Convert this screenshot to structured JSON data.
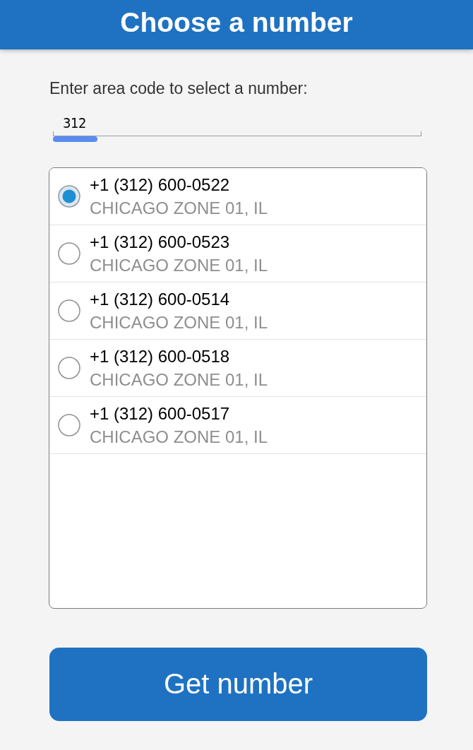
{
  "header": {
    "title": "Choose a number"
  },
  "area_code": {
    "label": "Enter area code to select a number:",
    "value": "312"
  },
  "numbers": [
    {
      "number": "+1 (312) 600-0522",
      "location": "CHICAGO ZONE 01, IL",
      "selected": true
    },
    {
      "number": "+1 (312) 600-0523",
      "location": "CHICAGO ZONE 01, IL",
      "selected": false
    },
    {
      "number": "+1 (312) 600-0514",
      "location": "CHICAGO ZONE 01, IL",
      "selected": false
    },
    {
      "number": "+1 (312) 600-0518",
      "location": "CHICAGO ZONE 01, IL",
      "selected": false
    },
    {
      "number": "+1 (312) 600-0517",
      "location": "CHICAGO ZONE 01, IL",
      "selected": false
    }
  ],
  "button": {
    "label": "Get number"
  }
}
